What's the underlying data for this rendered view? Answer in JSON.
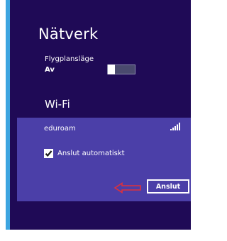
{
  "panel": {
    "title": "Nätverk",
    "background_color": "#1f0a56",
    "accent_color": "#3da5e0"
  },
  "airplane_mode": {
    "label": "Flygplansläge",
    "state_text": "Av",
    "enabled": false
  },
  "wifi": {
    "heading": "Wi-Fi",
    "network": {
      "name": "eduroam",
      "signal_icon": "wifi-signal-bars-icon",
      "card_color": "#4b3fa8"
    },
    "connect_automatically": {
      "label": "Anslut automatiskt",
      "checked": true
    },
    "connect_button_label": "Anslut",
    "annotation": {
      "icon": "red-outline-arrow-icon",
      "color": "#e0303a"
    }
  }
}
